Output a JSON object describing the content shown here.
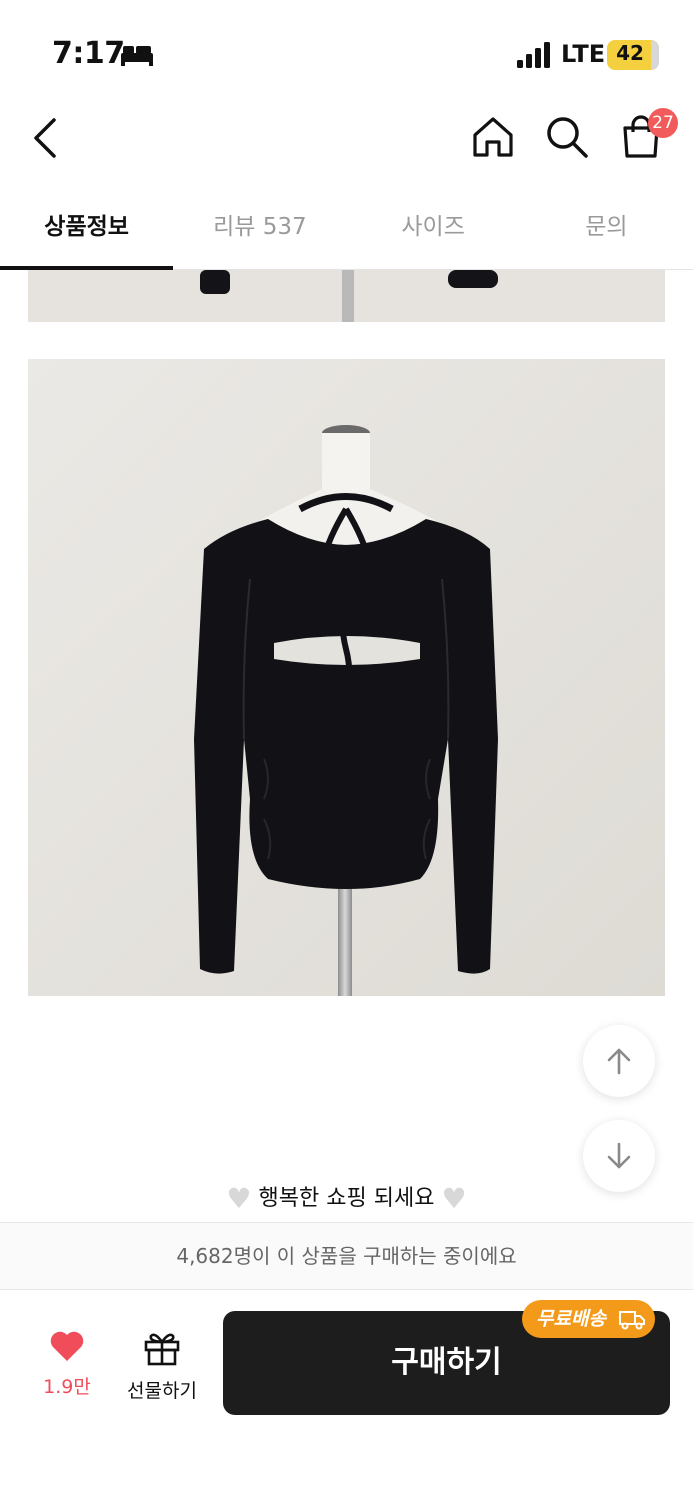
{
  "status_bar": {
    "time": "7:17",
    "network": "LTE",
    "battery": "42"
  },
  "header": {
    "cart_count": "27"
  },
  "tabs": [
    {
      "label": "상품정보",
      "active": true
    },
    {
      "label": "리뷰 537",
      "active": false
    },
    {
      "label": "사이즈",
      "active": false
    },
    {
      "label": "문의",
      "active": false
    }
  ],
  "content": {
    "closing_message": "행복한 쇼핑 되세요"
  },
  "bottom": {
    "buyers_notice": "4,682명이 이 상품을 구매하는 중이에요",
    "like_count": "1.9만",
    "gift_label": "선물하기",
    "buy_label": "구매하기",
    "shipping_badge": "무료배송"
  },
  "colors": {
    "accent_red": "#f15b5b",
    "buy_button": "#1d1d1d",
    "shipping_badge": "#f49a1a"
  },
  "icons": [
    "bed-icon",
    "signal-icon",
    "back-icon",
    "home-icon",
    "search-icon",
    "cart-icon",
    "arrow-up-icon",
    "arrow-down-icon",
    "heart-icon",
    "gift-icon",
    "truck-icon"
  ]
}
